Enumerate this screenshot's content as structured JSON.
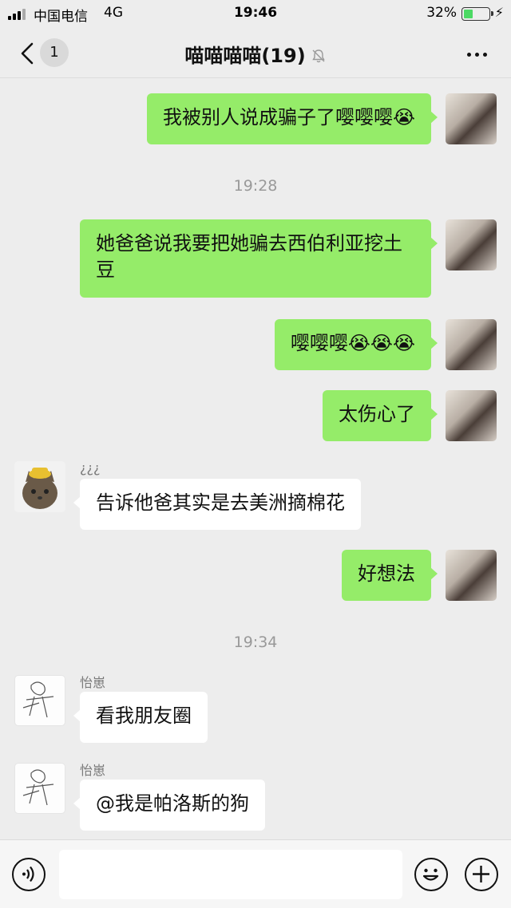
{
  "status": {
    "carrier": "中国电信",
    "network": "4G",
    "time": "19:46",
    "battery": "32%",
    "battery_level": 0.32
  },
  "nav": {
    "back_icon": "chevron-left-icon",
    "unread": "1",
    "title": "喵喵喵喵(19)",
    "mute_icon": "bell-off-icon",
    "more_icon": "ellipsis-icon"
  },
  "messages": [
    {
      "side": "out",
      "text": "我被别人说成骗子了嘤嘤嘤😭"
    },
    {
      "time": "19:28"
    },
    {
      "side": "out",
      "text": "她爸爸说我要把她骗去西伯利亚挖土豆"
    },
    {
      "side": "out",
      "text": "嘤嘤嘤😭😭😭"
    },
    {
      "side": "out",
      "text": "太伤心了"
    },
    {
      "side": "in",
      "sender": "¿¿¿",
      "text": "告诉他爸其实是去美洲摘棉花"
    },
    {
      "side": "out",
      "text": "好想法"
    },
    {
      "time": "19:34"
    },
    {
      "side": "in",
      "sender": "怡崽",
      "text": "看我朋友圈"
    },
    {
      "side": "in",
      "sender": "怡崽",
      "text": "@我是帕洛斯的狗"
    }
  ],
  "inputbar": {
    "voice_icon": "voice-icon",
    "emoji_icon": "emoji-icon",
    "plus_icon": "plus-icon"
  },
  "colors": {
    "outgoing_bubble": "#95ec69",
    "incoming_bubble": "#ffffff",
    "background": "#ededed"
  }
}
